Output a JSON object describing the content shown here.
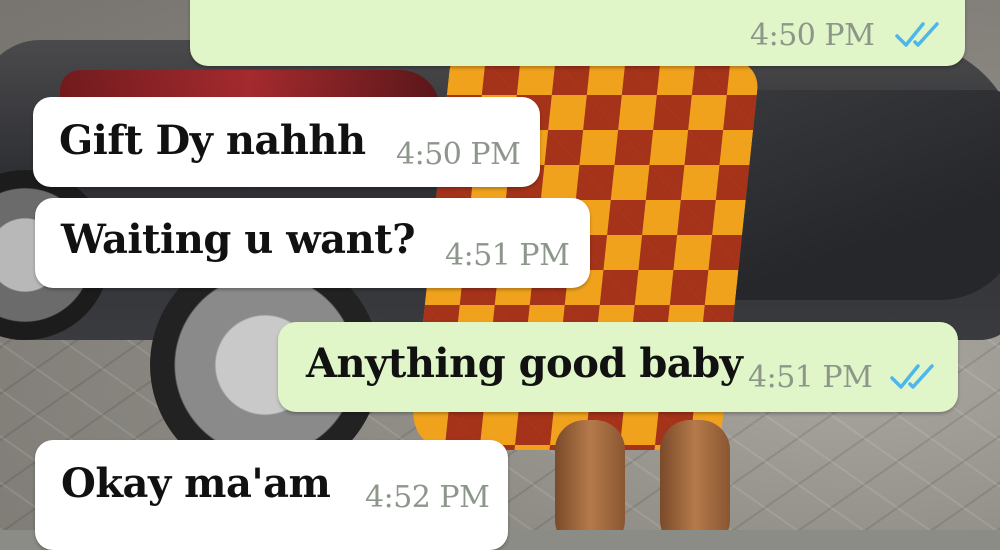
{
  "conversation": {
    "messages": [
      {
        "direction": "outgoing",
        "text": "",
        "time": "4:50 PM",
        "status": "read"
      },
      {
        "direction": "incoming",
        "text": "Gift Dy nahhh",
        "time": "4:50 PM"
      },
      {
        "direction": "incoming",
        "text": "Waiting u want?",
        "time": "4:51 PM"
      },
      {
        "direction": "outgoing",
        "text": "Anything good baby",
        "time": "4:51 PM",
        "status": "read"
      },
      {
        "direction": "incoming",
        "text": "Okay ma'am",
        "time": "4:52 PM"
      }
    ]
  },
  "colors": {
    "incoming_bubble": "#ffffff",
    "outgoing_bubble": "#e0f5c8",
    "read_ticks": "#4fb6ec",
    "timestamp": "#8d968a"
  },
  "icons": {
    "read_receipt": "double-check-icon"
  }
}
